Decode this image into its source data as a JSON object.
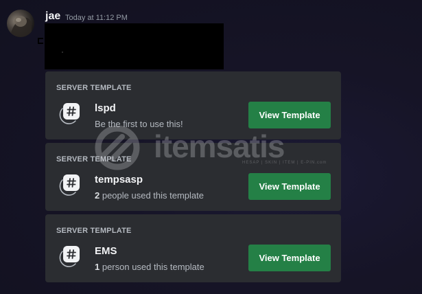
{
  "message": {
    "username": "jae",
    "timestamp": "Today at 11:12 PM"
  },
  "template_cards": [
    {
      "header": "SERVER TEMPLATE",
      "name": "lspd",
      "usage_count": "",
      "usage_text": "Be the first to use this!",
      "button_label": "View Template",
      "icon": "hash-icon"
    },
    {
      "header": "SERVER TEMPLATE",
      "name": "tempsasp",
      "usage_count": "2",
      "usage_text": " people used this template",
      "button_label": "View Template",
      "icon": "hash-icon"
    },
    {
      "header": "SERVER TEMPLATE",
      "name": "EMS",
      "usage_count": "1",
      "usage_text": " person used this template",
      "button_label": "View Template",
      "icon": "hash-icon"
    }
  ],
  "watermark": {
    "brand": "itemsatis",
    "tagline": "HESAP | SKIN | ITEM | E-PIN",
    "domain": ".com"
  },
  "colors": {
    "card_background": "#2b2d31",
    "button_green": "#248046",
    "page_background": "#161426"
  }
}
